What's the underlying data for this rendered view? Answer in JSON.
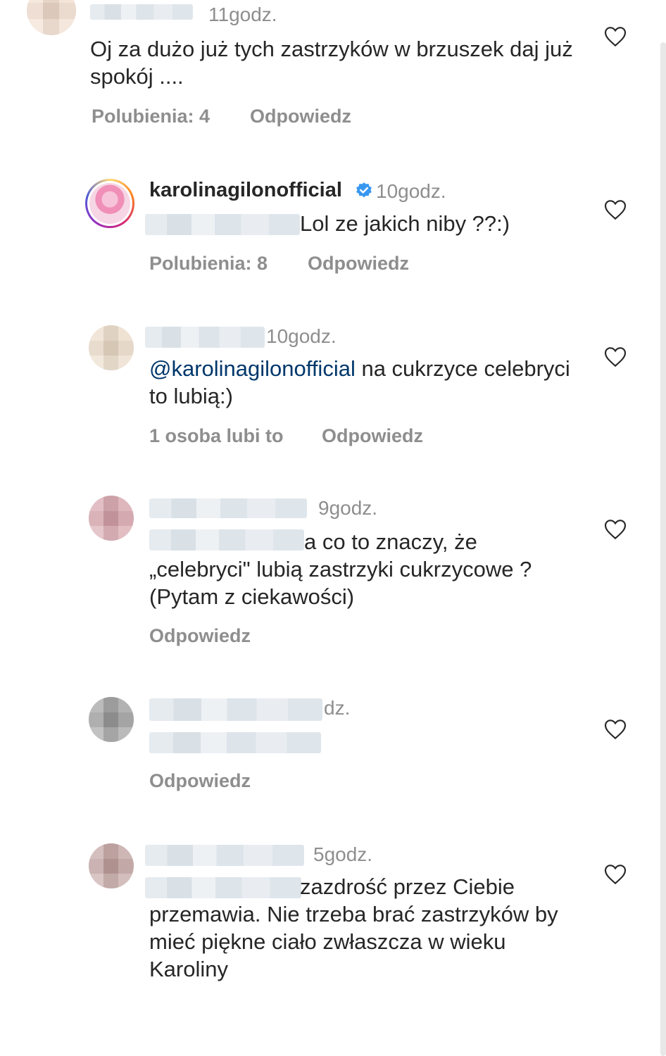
{
  "comments": [
    {
      "username": "",
      "time": "11godz.",
      "text": "Oj za dużo już tych zastrzyków w brzuszek daj już spokój ....",
      "likes": "Polubienia: 4",
      "reply": "Odpowiedz"
    },
    {
      "username": "karolinagilonofficial",
      "time": "10godz.",
      "text": "Lol ze jakich niby ??:)",
      "likes": "Polubienia: 8",
      "reply": "Odpowiedz"
    },
    {
      "username": "",
      "time": "10godz.",
      "mention": "@karolinagilonofficial",
      "text": " na cukrzyce celebryci to lubią:)",
      "likes": "1 osoba lubi to",
      "reply": "Odpowiedz"
    },
    {
      "username": "",
      "time": "9godz.",
      "text": "a co to znaczy, że „celebryci\" lubią zastrzyki cukrzycowe ? (Pytam z ciekawości)",
      "reply": "Odpowiedz"
    },
    {
      "username": "",
      "time": "dz.",
      "text": "",
      "reply": "Odpowiedz"
    },
    {
      "username": "",
      "time": "5godz.",
      "text": "zazdrość przez Ciebie przemawia. Nie trzeba brać zastrzyków by mieć piękne ciało zwłaszcza w wieku Karoliny"
    }
  ],
  "icons": {
    "like": "heart-outline-icon",
    "verified": "verified-badge-icon"
  },
  "colors": {
    "text": "#262626",
    "secondary": "#8e8e8e",
    "mention": "#00376b",
    "verified": "#3897f0"
  }
}
